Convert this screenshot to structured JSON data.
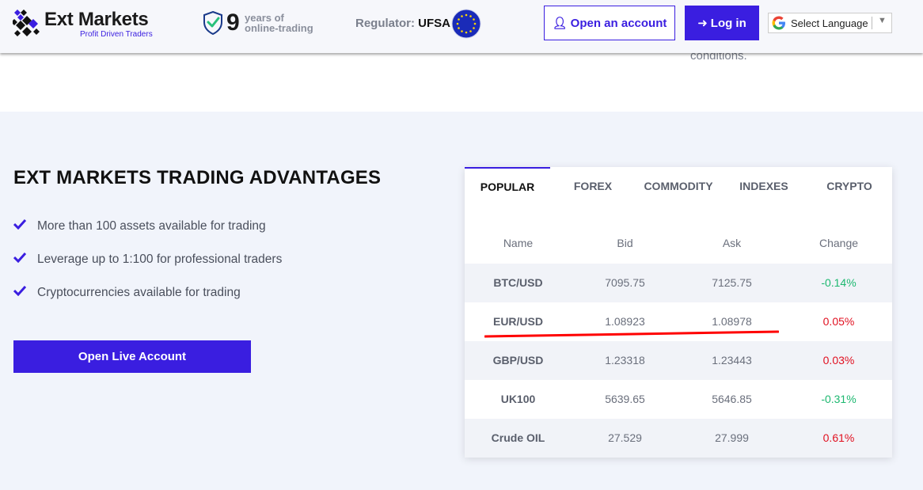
{
  "header": {
    "logo": {
      "name": "Ext Markets",
      "tagline": "Profit Driven Traders"
    },
    "experience": {
      "number": "9",
      "line1": "years of",
      "line2": "online-trading"
    },
    "regulator": {
      "label": "Regulator:",
      "value": "UFSA"
    },
    "open_account_label": "Open an account",
    "login_label": "Log in",
    "language_label": "Select Language"
  },
  "partial_text": "conditions.",
  "advantages": {
    "title": "EXT MARKETS TRADING ADVANTAGES",
    "items": [
      "More than 100 assets available for trading",
      "Leverage up to 1:100 for professional traders",
      "Cryptocurrencies available for trading"
    ],
    "cta_label": "Open Live Account"
  },
  "widget": {
    "tabs": [
      "POPULAR",
      "FOREX",
      "COMMODITY",
      "INDEXES",
      "CRYPTO"
    ],
    "active_tab": "POPULAR",
    "columns": [
      "Name",
      "Bid",
      "Ask",
      "Change"
    ],
    "rows": [
      {
        "name": "BTC/USD",
        "bid": "7095.75",
        "ask": "7125.75",
        "change": "-0.14%",
        "direction": "up"
      },
      {
        "name": "EUR/USD",
        "bid": "1.08923",
        "ask": "1.08978",
        "change": "0.05%",
        "direction": "down"
      },
      {
        "name": "GBP/USD",
        "bid": "1.23318",
        "ask": "1.23443",
        "change": "0.03%",
        "direction": "down"
      },
      {
        "name": "UK100",
        "bid": "5639.65",
        "ask": "5646.85",
        "change": "-0.31%",
        "direction": "up"
      },
      {
        "name": "Crude OIL",
        "bid": "27.529",
        "ask": "27.999",
        "change": "0.61%",
        "direction": "down"
      }
    ]
  },
  "colors": {
    "brand": "#3a1ee0",
    "positive": "#1db870",
    "negative": "#e11020",
    "annotation": "#ff0000"
  }
}
